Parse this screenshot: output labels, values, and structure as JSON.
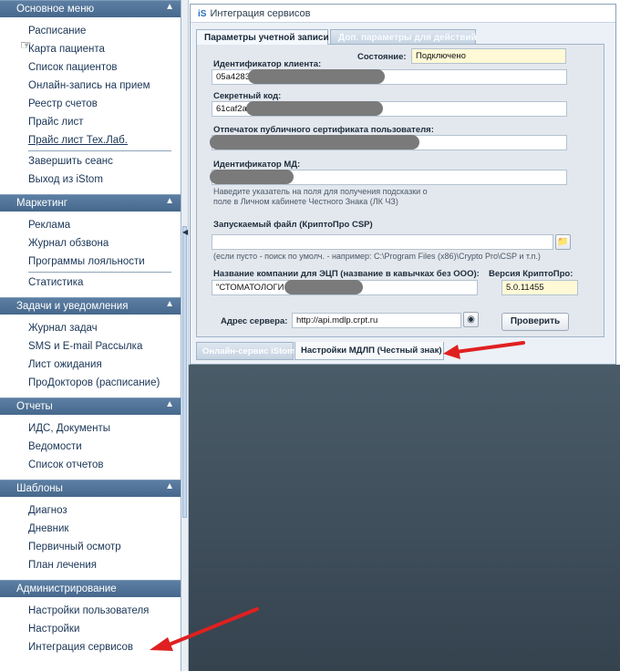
{
  "sidebar": {
    "sections": [
      {
        "title": "Основное меню",
        "items": [
          "Расписание",
          "Карта пациента",
          "Список пациентов",
          "Онлайн-запись на прием",
          "Реестр счетов",
          "Прайс лист",
          "Прайс лист Тех.Лаб.",
          "Завершить сеанс",
          "Выход из iStom"
        ]
      },
      {
        "title": "Маркетинг",
        "items": [
          "Реклама",
          "Журнал обзвона",
          "Программы лояльности",
          "Статистика"
        ]
      },
      {
        "title": "Задачи и уведомления",
        "items": [
          "Журнал задач",
          "SMS и E-mail Рассылка",
          "Лист ожидания",
          "ПроДокторов (расписание)"
        ]
      },
      {
        "title": "Отчеты",
        "items": [
          "ИДС, Документы",
          "Ведомости",
          "Список отчетов"
        ]
      },
      {
        "title": "Шаблоны",
        "items": [
          "Диагноз",
          "Дневник",
          "Первичный осмотр",
          "План лечения"
        ]
      },
      {
        "title": "Администрирование",
        "items": [
          "Настройки пользователя",
          "Настройки",
          "Интеграция сервисов"
        ]
      }
    ]
  },
  "window": {
    "title": "Интеграция сервисов",
    "tabs": [
      "Параметры учетной записи",
      "Доп. параметры для действий"
    ],
    "status_label": "Состояние:",
    "status_value": "Подключено",
    "client_id_label": "Идентификатор клиента:",
    "client_id_value": "05a4283",
    "secret_label": "Секретный код:",
    "secret_value": "61caf2a",
    "cert_label": "Отпечаток публичного сертификата пользователя:",
    "md_label": "Идентификатор МД:",
    "md_hint": "Наведите указатель на поля для получения подсказки о поле в Личном кабинете Честного Знака (ЛК ЧЗ)",
    "file_label": "Запускаемый файл  (КриптоПро CSP)",
    "file_hint": "(если пусто - поиск по умолч. - например: C:\\Program Files (x86)\\Crypto Pro\\CSP и т.п.)",
    "company_label": "Название компании для ЭЦП  (название в кавычках без ООО):",
    "company_value": "\"СТОМАТОЛОГИ",
    "crypto_label": "Версия КриптоПро:",
    "crypto_value": "5.0.11455",
    "server_label": "Адрес сервера:",
    "server_value": "http://api.mdlp.crpt.ru",
    "check_button": "Проверить",
    "bottom_tabs": [
      "Онлайн-сервис iStom",
      "Настройки МДЛП (Честный знак)"
    ]
  },
  "colors": {
    "accent": "#4d6f94",
    "arrow": "#e02020"
  }
}
